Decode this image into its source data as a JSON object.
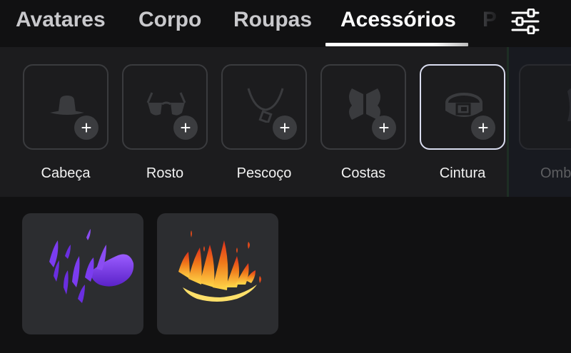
{
  "tabs": {
    "items": [
      {
        "label": "Avatares"
      },
      {
        "label": "Corpo"
      },
      {
        "label": "Roupas"
      },
      {
        "label": "Acessórios"
      },
      {
        "label": "P"
      }
    ],
    "active": "Acessórios"
  },
  "filter": {
    "icon": "sliders-icon"
  },
  "categories": [
    {
      "label": "Cabeça",
      "icon": "hat-icon"
    },
    {
      "label": "Rosto",
      "icon": "glasses-icon"
    },
    {
      "label": "Pescoço",
      "icon": "necklace-icon"
    },
    {
      "label": "Costas",
      "icon": "wings-icon"
    },
    {
      "label": "Cintura",
      "icon": "belt-icon",
      "selected": true
    },
    {
      "label": "Omb",
      "icon": "shoulder-icon"
    }
  ],
  "plus_symbol": "+",
  "items": [
    {
      "name": "purple-flames-accessory",
      "icon": "purple-flames-icon"
    },
    {
      "name": "orange-flames-accessory",
      "icon": "orange-flames-icon"
    }
  ],
  "colors": {
    "background": "#111112",
    "panel": "#1c1c1e",
    "card": "#2c2d30",
    "selected_border": "#d9dcef",
    "purple_flame": "#7b3cf0",
    "orange_flame": "#f07a1a"
  }
}
